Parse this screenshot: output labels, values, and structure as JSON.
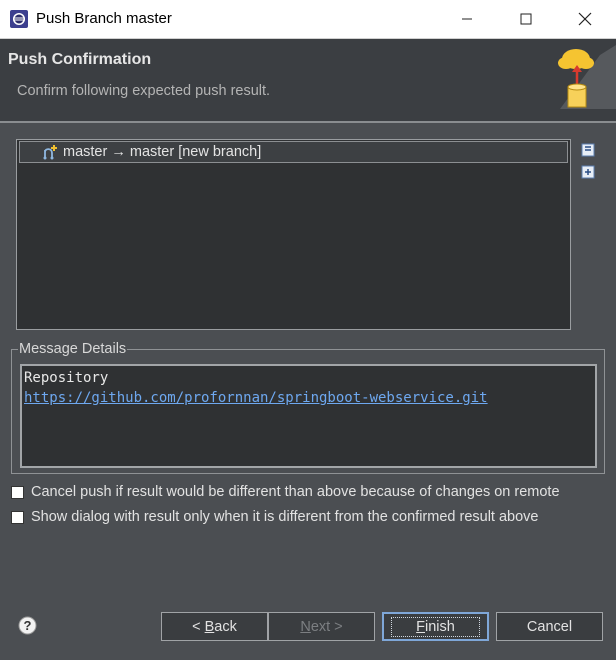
{
  "window": {
    "title": "Push Branch master",
    "icon": "eclipse-icon",
    "controls": [
      "minimize-icon",
      "maximize-icon",
      "close-icon"
    ]
  },
  "header": {
    "title": "Push Confirmation",
    "description": "Confirm following expected push result.",
    "banner_icon": "cloud-push-icon"
  },
  "tree": {
    "rows": [
      {
        "label": "master → master [new branch]",
        "icon": "new-branch-icon"
      }
    ],
    "side_buttons": [
      "collapse-all-icon",
      "expand-all-icon"
    ]
  },
  "message_details": {
    "legend": "Message Details",
    "repository_label": "Repository",
    "repository_url": "https://github.com/profornnan/springboot-webservice.git"
  },
  "options": [
    {
      "label": "Cancel push if result would be different than above because of changes on remote",
      "checked": false
    },
    {
      "label": "Show dialog with result only when it is different from the confirmed result above",
      "checked": false
    }
  ],
  "buttons": {
    "back": {
      "prefix": "< ",
      "mnemonic": "B",
      "rest": "ack",
      "enabled": true
    },
    "next": {
      "mnemonic": "N",
      "rest": "ext >",
      "enabled": false
    },
    "finish": {
      "mnemonic": "F",
      "rest": "inish",
      "enabled": true,
      "default": true
    },
    "cancel": {
      "label": "Cancel",
      "enabled": true
    }
  },
  "colors": {
    "dialog_bg": "#4b4e52",
    "header_bg": "#3b3e42",
    "link": "#6ea8f0",
    "default_button_border": "#7fa7d8"
  }
}
